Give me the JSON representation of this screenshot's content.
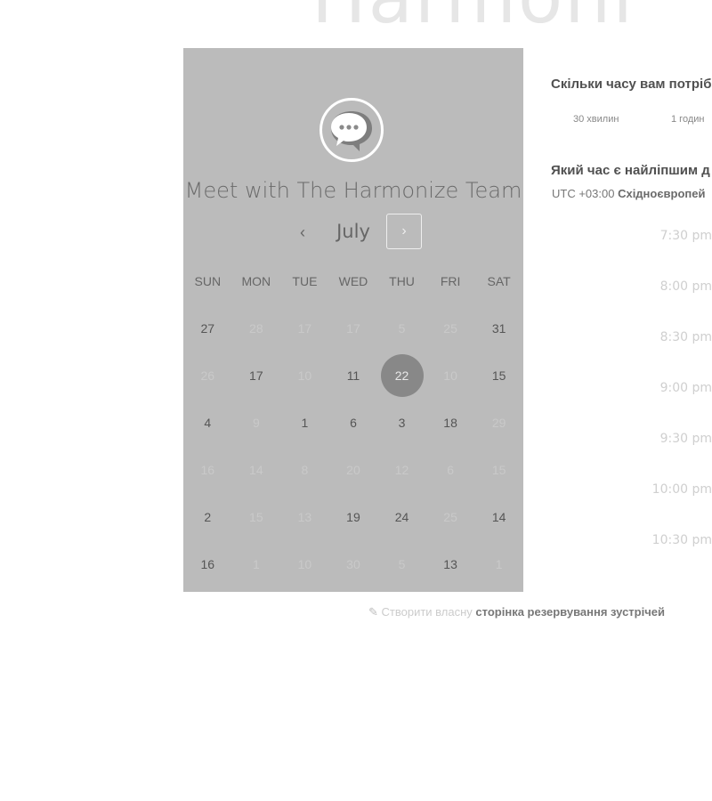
{
  "brand": {
    "name": "Harmoni"
  },
  "calendar": {
    "team_title": "Meet with The Harmonize Team",
    "month": "July",
    "prev_icon": "‹",
    "next_icon": "›",
    "weekdays": [
      "SUN",
      "MON",
      "TUE",
      "WED",
      "THU",
      "FRI",
      "SAT"
    ],
    "weeks": [
      [
        {
          "d": "27",
          "s": "on"
        },
        {
          "d": "28",
          "s": "off"
        },
        {
          "d": "17",
          "s": "off"
        },
        {
          "d": "17",
          "s": "off"
        },
        {
          "d": "5",
          "s": "off"
        },
        {
          "d": "25",
          "s": "off"
        },
        {
          "d": "31",
          "s": "on"
        }
      ],
      [
        {
          "d": "26",
          "s": "off"
        },
        {
          "d": "17",
          "s": "on"
        },
        {
          "d": "10",
          "s": "off"
        },
        {
          "d": "11",
          "s": "on"
        },
        {
          "d": "22",
          "s": "sel"
        },
        {
          "d": "10",
          "s": "off"
        },
        {
          "d": "15",
          "s": "on"
        }
      ],
      [
        {
          "d": "4",
          "s": "on"
        },
        {
          "d": "9",
          "s": "off"
        },
        {
          "d": "1",
          "s": "on"
        },
        {
          "d": "6",
          "s": "on"
        },
        {
          "d": "3",
          "s": "on"
        },
        {
          "d": "18",
          "s": "on"
        },
        {
          "d": "29",
          "s": "off"
        }
      ],
      [
        {
          "d": "16",
          "s": "off"
        },
        {
          "d": "14",
          "s": "off"
        },
        {
          "d": "8",
          "s": "off"
        },
        {
          "d": "20",
          "s": "off"
        },
        {
          "d": "12",
          "s": "off"
        },
        {
          "d": "6",
          "s": "off"
        },
        {
          "d": "15",
          "s": "off"
        }
      ],
      [
        {
          "d": "2",
          "s": "on"
        },
        {
          "d": "15",
          "s": "off"
        },
        {
          "d": "13",
          "s": "off"
        },
        {
          "d": "19",
          "s": "on"
        },
        {
          "d": "24",
          "s": "on"
        },
        {
          "d": "25",
          "s": "off"
        },
        {
          "d": "14",
          "s": "on"
        }
      ],
      [
        {
          "d": "16",
          "s": "on"
        },
        {
          "d": "1",
          "s": "off"
        },
        {
          "d": "10",
          "s": "off"
        },
        {
          "d": "30",
          "s": "off"
        },
        {
          "d": "5",
          "s": "off"
        },
        {
          "d": "13",
          "s": "on"
        },
        {
          "d": "1",
          "s": "off"
        }
      ]
    ]
  },
  "booking": {
    "duration_question": "Скільки часу вам потріб",
    "duration_options": [
      "30 хвилин",
      "1 годин"
    ],
    "time_question": "Який час є найліпшим д",
    "timezone_offset": "UTC +03:00",
    "timezone_name": "Східноєвропей",
    "time_slots": [
      "7:30 pm",
      "8:00 pm",
      "8:30 pm",
      "9:00 pm",
      "9:30 pm",
      "10:00 pm",
      "10:30 pm"
    ]
  },
  "footer": {
    "sprout_icon": "sprout-icon",
    "create_text": "Створити власну",
    "link_text": "сторінка резервування зустрічей"
  }
}
